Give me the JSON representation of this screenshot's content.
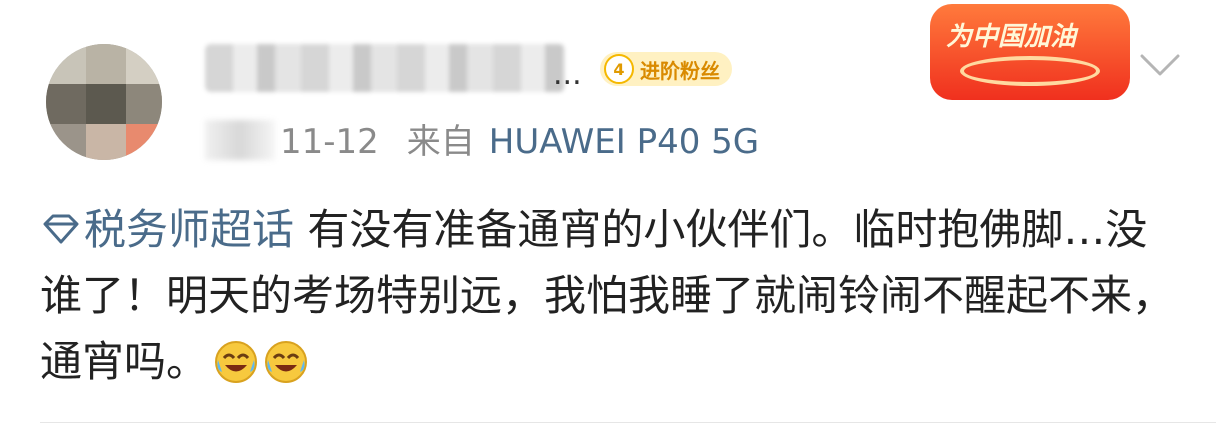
{
  "post": {
    "author": {
      "name_visible": "...",
      "fan_badge": {
        "level": "4",
        "label": "进阶粉丝"
      }
    },
    "meta": {
      "date": "11-12",
      "source_prefix": "来自",
      "device": "HUAWEI P40 5G"
    },
    "sticker": {
      "text": "为中国加油"
    },
    "body": {
      "topic": "税务师超话",
      "text": "有没有准备通宵的小伙伴们。临时抱佛脚…没谁了！明天的考场特别远，我怕我睡了就闹铃闹不醒起不来，通宵吗。",
      "emojis": [
        "laugh-cry-emoji",
        "laugh-cry-emoji"
      ]
    }
  },
  "colors": {
    "link": "#4a6b8a",
    "meta_text": "#8a8a8a",
    "badge_bg": "#fff1c2",
    "sticker_red": "#f0301e"
  }
}
